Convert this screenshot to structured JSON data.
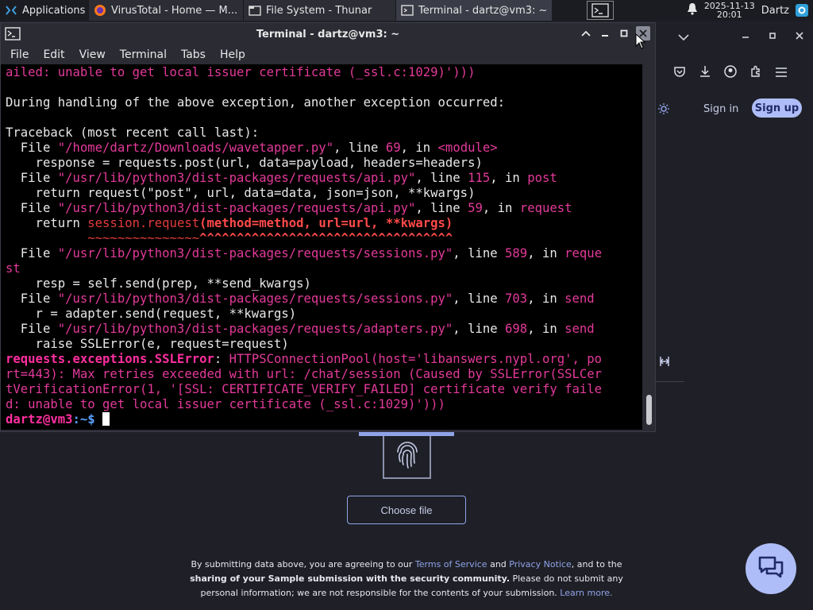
{
  "panel": {
    "applications_label": "Applications",
    "tasks": [
      {
        "label": "VirusTotal - Home — M..."
      },
      {
        "label": "File System - Thunar"
      },
      {
        "label": "Terminal - dartz@vm3: ~"
      }
    ],
    "clock_date": "2025-11-13",
    "clock_time": "20:01",
    "user": "Dartz"
  },
  "terminal": {
    "title": "Terminal - dartz@vm3: ~",
    "menu": [
      "File",
      "Edit",
      "View",
      "Terminal",
      "Tabs",
      "Help"
    ],
    "lines": [
      {
        "segments": [
          {
            "t": "ailed: unable to get local issuer certificate (_ssl.c:1029)')))",
            "c": "pink"
          }
        ]
      },
      {
        "segments": [
          {
            "t": "",
            "c": ""
          }
        ]
      },
      {
        "segments": [
          {
            "t": "During handling of the above exception, another exception occurred:",
            "c": ""
          }
        ]
      },
      {
        "segments": [
          {
            "t": "",
            "c": ""
          }
        ]
      },
      {
        "segments": [
          {
            "t": "Traceback (most recent call last):",
            "c": ""
          }
        ]
      },
      {
        "segments": [
          {
            "t": "  File ",
            "c": ""
          },
          {
            "t": "\"/home/dartz/Downloads/wavetapper.py\"",
            "c": "pink"
          },
          {
            "t": ", line ",
            "c": ""
          },
          {
            "t": "69",
            "c": "pink"
          },
          {
            "t": ", in ",
            "c": ""
          },
          {
            "t": "<module>",
            "c": "pink"
          }
        ]
      },
      {
        "segments": [
          {
            "t": "    response = requests.post(url, data=payload, headers=headers)",
            "c": ""
          }
        ]
      },
      {
        "segments": [
          {
            "t": "  File ",
            "c": ""
          },
          {
            "t": "\"/usr/lib/python3/dist-packages/requests/api.py\"",
            "c": "pink"
          },
          {
            "t": ", line ",
            "c": ""
          },
          {
            "t": "115",
            "c": "pink"
          },
          {
            "t": ", in ",
            "c": ""
          },
          {
            "t": "post",
            "c": "pink"
          }
        ]
      },
      {
        "segments": [
          {
            "t": "    return request(\"post\", url, data=data, json=json, **kwargs)",
            "c": ""
          }
        ]
      },
      {
        "segments": [
          {
            "t": "  File ",
            "c": ""
          },
          {
            "t": "\"/usr/lib/python3/dist-packages/requests/api.py\"",
            "c": "pink"
          },
          {
            "t": ", line ",
            "c": ""
          },
          {
            "t": "59",
            "c": "pink"
          },
          {
            "t": ", in ",
            "c": ""
          },
          {
            "t": "request",
            "c": "pink"
          }
        ]
      },
      {
        "segments": [
          {
            "t": "    return ",
            "c": ""
          },
          {
            "t": "session.request",
            "c": "redl"
          },
          {
            "t": "(method=method, url=url, **kwargs)",
            "c": "red"
          }
        ]
      },
      {
        "segments": [
          {
            "t": "           ~~~~~~~~~~~~~~~",
            "c": "redl"
          },
          {
            "t": "^^^^^^^^^^^^^^^^^^^^^^^^^^^^^^^^^^",
            "c": "red"
          }
        ]
      },
      {
        "segments": [
          {
            "t": "  File ",
            "c": ""
          },
          {
            "t": "\"/usr/lib/python3/dist-packages/requests/sessions.py\"",
            "c": "pink"
          },
          {
            "t": ", line ",
            "c": ""
          },
          {
            "t": "589",
            "c": "pink"
          },
          {
            "t": ", in ",
            "c": ""
          },
          {
            "t": "reque",
            "c": "pink"
          }
        ]
      },
      {
        "segments": [
          {
            "t": "st",
            "c": "pink"
          }
        ]
      },
      {
        "segments": [
          {
            "t": "    resp = self.send(prep, **send_kwargs)",
            "c": ""
          }
        ]
      },
      {
        "segments": [
          {
            "t": "  File ",
            "c": ""
          },
          {
            "t": "\"/usr/lib/python3/dist-packages/requests/sessions.py\"",
            "c": "pink"
          },
          {
            "t": ", line ",
            "c": ""
          },
          {
            "t": "703",
            "c": "pink"
          },
          {
            "t": ", in ",
            "c": ""
          },
          {
            "t": "send",
            "c": "pink"
          }
        ]
      },
      {
        "segments": [
          {
            "t": "    r = adapter.send(request, **kwargs)",
            "c": ""
          }
        ]
      },
      {
        "segments": [
          {
            "t": "  File ",
            "c": ""
          },
          {
            "t": "\"/usr/lib/python3/dist-packages/requests/adapters.py\"",
            "c": "pink"
          },
          {
            "t": ", line ",
            "c": ""
          },
          {
            "t": "698",
            "c": "pink"
          },
          {
            "t": ", in ",
            "c": ""
          },
          {
            "t": "send",
            "c": "pink"
          }
        ]
      },
      {
        "segments": [
          {
            "t": "    raise SSLError(e, request=request)",
            "c": ""
          }
        ]
      },
      {
        "segments": [
          {
            "t": "requests.exceptions.SSLError",
            "c": "pinkb"
          },
          {
            "t": ": ",
            "c": ""
          },
          {
            "t": "HTTPSConnectionPool(host='libanswers.nypl.org', po",
            "c": "pink"
          }
        ]
      },
      {
        "segments": [
          {
            "t": "rt=443): Max retries exceeded with url: /chat/session (Caused by SSLError(SSLCer",
            "c": "pink"
          }
        ]
      },
      {
        "segments": [
          {
            "t": "tVerificationError(1, '[SSL: CERTIFICATE_VERIFY_FAILED] certificate verify faile",
            "c": "pink"
          }
        ]
      },
      {
        "segments": [
          {
            "t": "d: unable to get local issuer certificate (_ssl.c:1029)')))",
            "c": "pink"
          }
        ]
      }
    ],
    "prompt_user": "dartz@vm3",
    "prompt_path": ":~$ "
  },
  "browser": {
    "signin_label": "Sign in",
    "signup_label": "Sign up",
    "choose_file_label": "Choose file",
    "legal": {
      "p1": "By submitting data above, you are agreeing to our ",
      "terms": "Terms of Service",
      "and": " and ",
      "privacy": "Privacy Notice",
      "p2": ", and to the ",
      "bold": "sharing of your Sample submission with the security community.",
      "p3": " Please do not submit any personal information; we are not responsible for the contents of your submission. ",
      "learn": "Learn more."
    }
  },
  "colors": {
    "accent": "#aebdf7",
    "terminal_bg": "#000000",
    "error_pink": "#e33a9a"
  }
}
